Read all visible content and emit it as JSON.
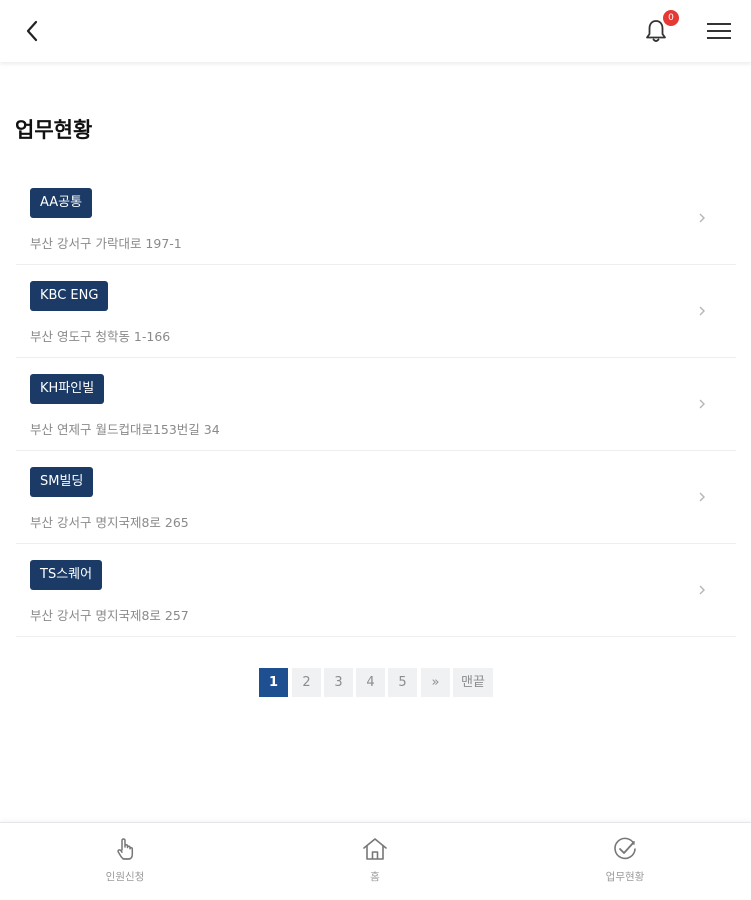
{
  "header": {
    "back_icon": "chevron-left-icon",
    "bell_icon": "bell-icon",
    "notification_count": "0",
    "menu_icon": "hamburger-menu-icon"
  },
  "page_title": "업무현황",
  "sites": [
    {
      "name": "AA공통",
      "address": "부산 강서구 가락대로 197-1"
    },
    {
      "name": "KBC ENG",
      "address": "부산 영도구 청학동 1-166"
    },
    {
      "name": "KH파인빌",
      "address": "부산 연제구 월드컵대로153번길 34"
    },
    {
      "name": "SM빌딩",
      "address": "부산 강서구 명지국제8로 265"
    },
    {
      "name": "TS스퀘어",
      "address": "부산 강서구 명지국제8로 257"
    }
  ],
  "pagination": {
    "pages": [
      "1",
      "2",
      "3",
      "4",
      "5"
    ],
    "current": "1",
    "next_label": "»",
    "last_label": "맨끝"
  },
  "tabbar": {
    "tabs": [
      {
        "label": "인원신청",
        "icon": "hand-tap-icon"
      },
      {
        "label": "홈",
        "icon": "home-icon"
      },
      {
        "label": "업무현황",
        "icon": "check-circle-icon"
      }
    ]
  },
  "colors": {
    "badge_bg": "#1b3a66",
    "pager_active": "#1d4f91",
    "notification_badge": "#e53935"
  }
}
